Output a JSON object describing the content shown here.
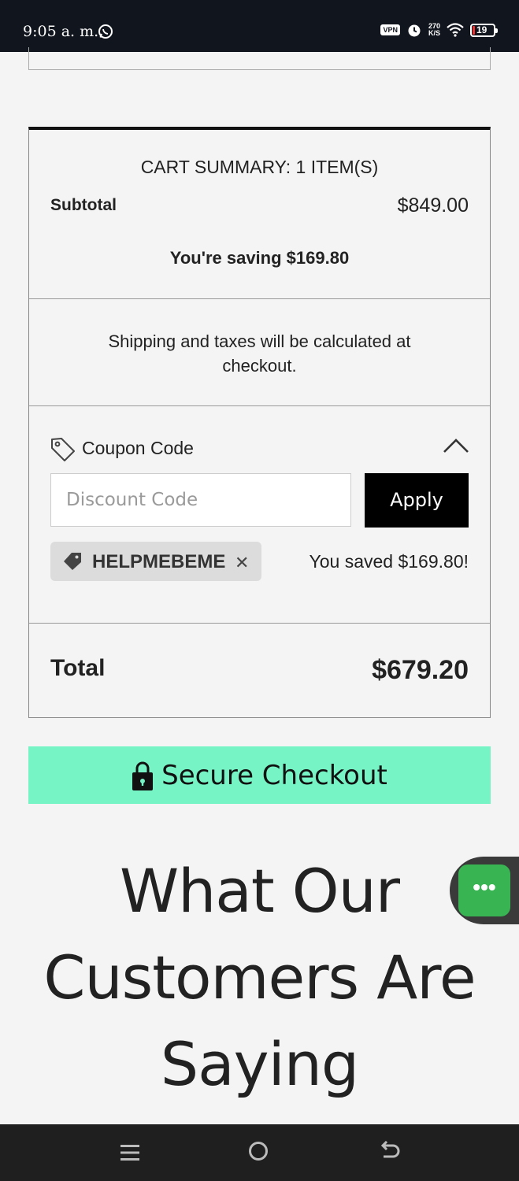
{
  "status_bar": {
    "time": "9:05 a. m.",
    "vpn": "VPN",
    "speed_value": "270",
    "speed_unit": "K/S",
    "battery": "19"
  },
  "cart_summary": {
    "title": "CART SUMMARY: 1 ITEM(S)",
    "subtotal_label": "Subtotal",
    "subtotal_value": "$849.00",
    "saving_text": "You're saving $169.80",
    "shipping_note": "Shipping and taxes will be calculated at checkout.",
    "coupon_label": "Coupon Code",
    "discount_placeholder": "Discount Code",
    "apply_label": "Apply",
    "applied_code": "HELPMEBEME",
    "saved_text": "You saved $169.80!",
    "total_label": "Total",
    "total_value": "$679.20"
  },
  "checkout_label": "Secure Checkout",
  "section_heading": "What Our Customers Are Saying",
  "chat_button_label": "•••",
  "colors": {
    "checkout_bg": "#76f4c6",
    "apply_bg": "#000000",
    "chat_bg": "#38b552",
    "status_bar_bg": "#11151e"
  }
}
